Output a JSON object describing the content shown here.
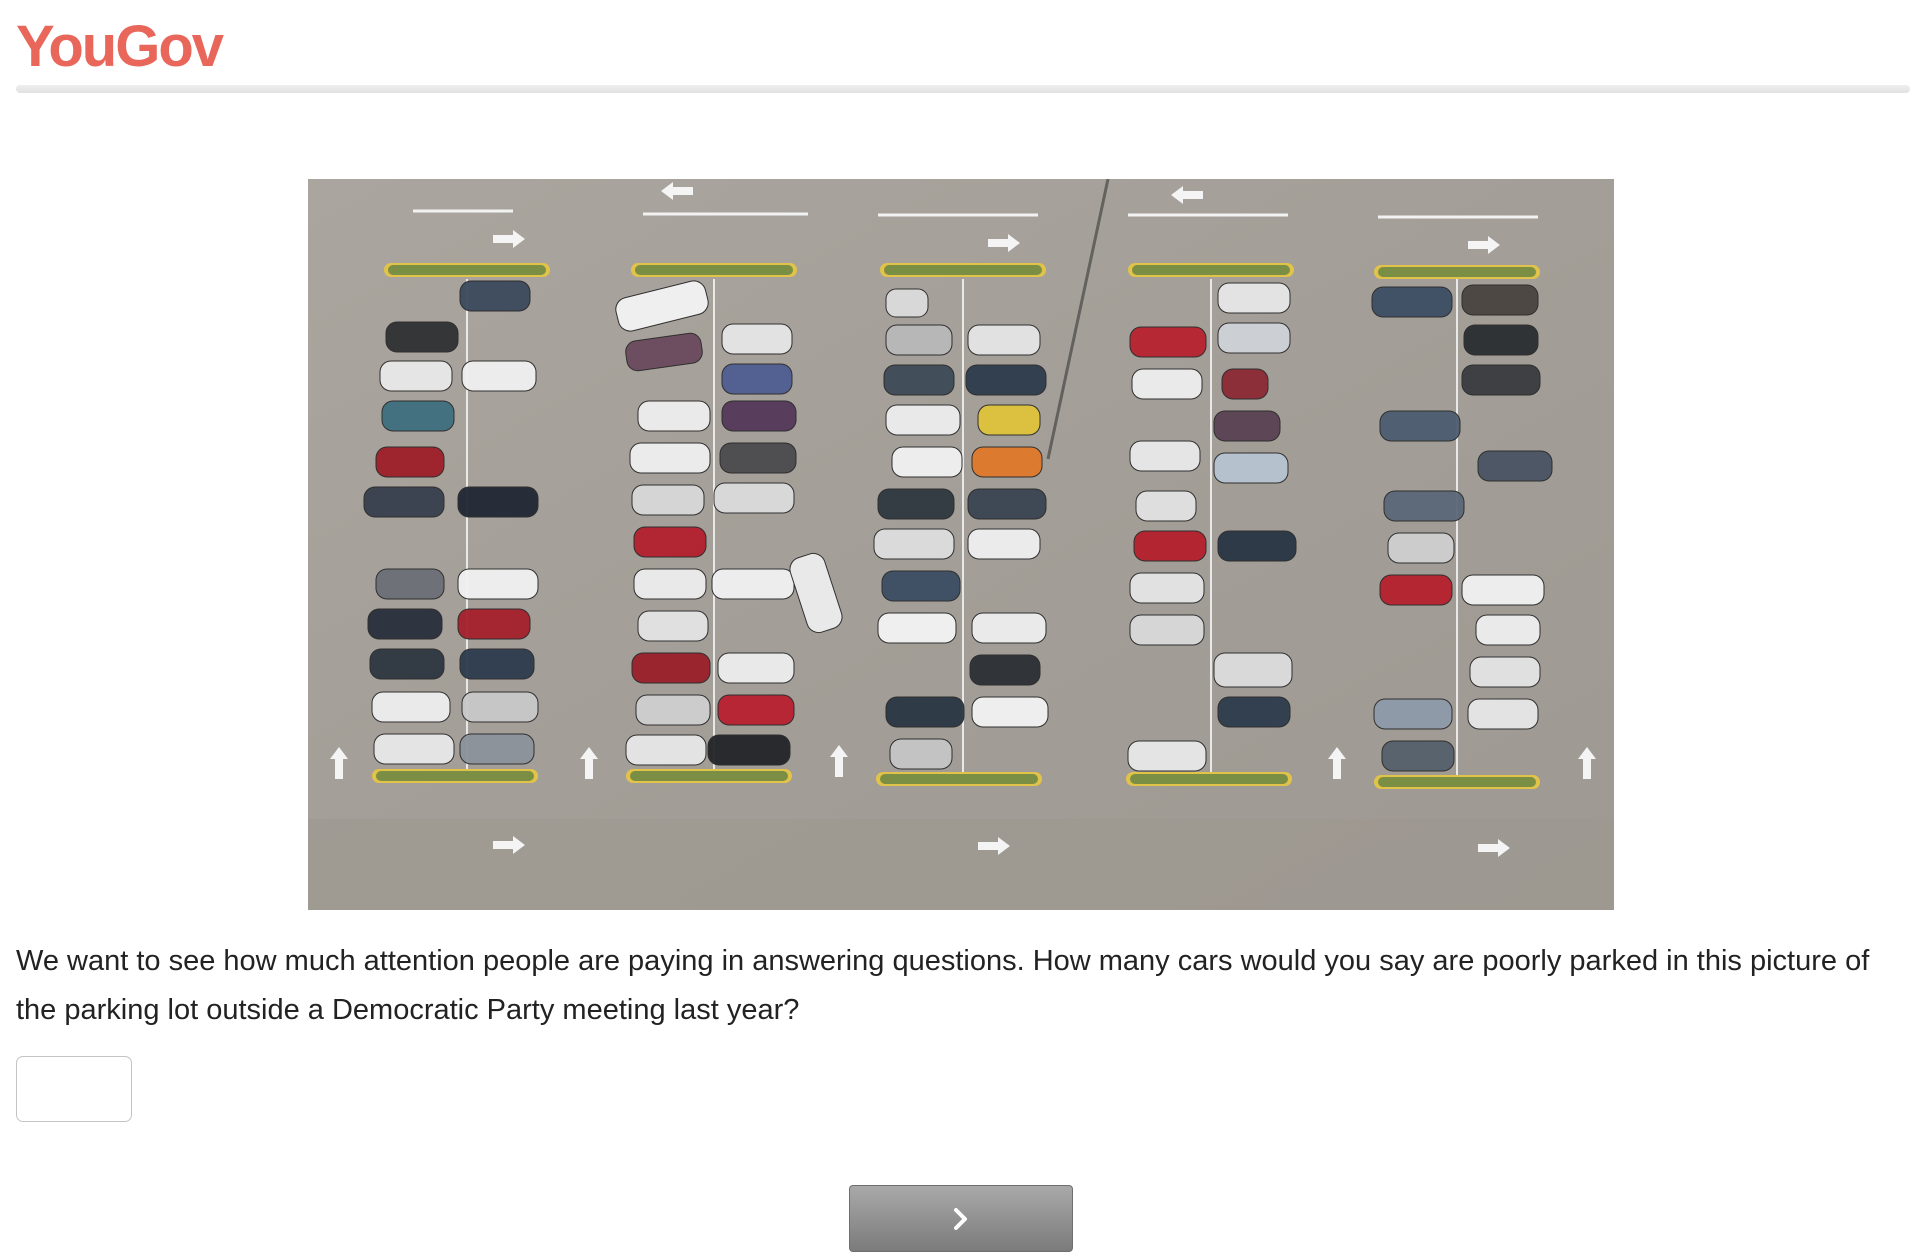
{
  "brand": {
    "logo_text": "YouGov",
    "color": "#e8675a"
  },
  "photo": {
    "alt": "Aerial view of a parking lot"
  },
  "question": {
    "text": "We want to see how much attention people are paying in answering questions. How many cars would you say are poorly parked in this picture of the parking lot outside a Democratic Party meeting last year?"
  },
  "answer": {
    "value": "",
    "placeholder": ""
  },
  "next_button": {
    "icon": "chevron-right-icon",
    "aria_label": "Next"
  },
  "colors": {
    "button": "#8e8e8e",
    "asphalt": "#a7a29b"
  }
}
